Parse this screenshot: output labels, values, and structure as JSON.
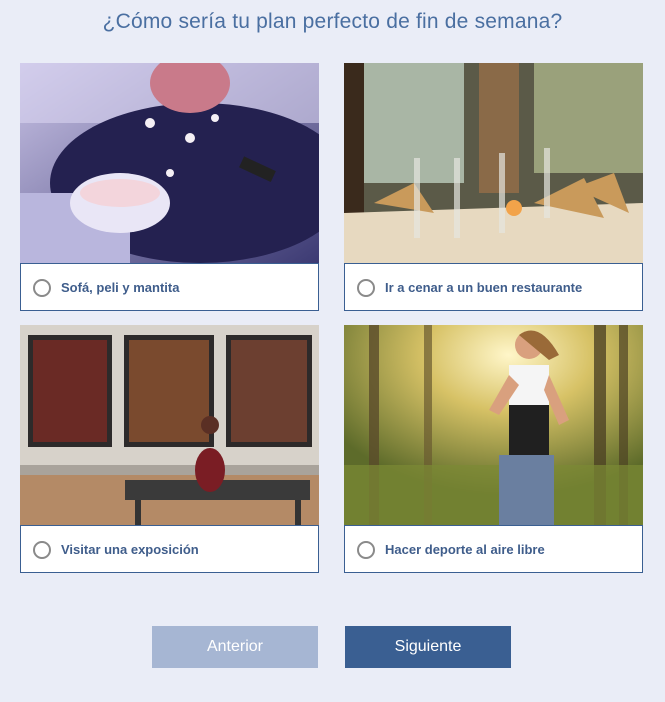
{
  "question": "¿Cómo sería tu plan perfecto de fin de semana?",
  "options": [
    {
      "label": "Sofá, peli y mantita",
      "image": "woman-on-sofa-with-popcorn-photo"
    },
    {
      "label": "Ir a cenar a un buen restaurante",
      "image": "restaurant-table-photo"
    },
    {
      "label": "Visitar una exposición",
      "image": "art-gallery-paintings-photo"
    },
    {
      "label": "Hacer deporte al aire libre",
      "image": "woman-jogging-in-forest-photo"
    }
  ],
  "buttons": {
    "previous": "Anterior",
    "next": "Siguiente"
  },
  "colors": {
    "background": "#eaedf7",
    "accent": "#3a5f92",
    "disabled_button": "#a6b6d3",
    "title": "#4a6fa1"
  }
}
